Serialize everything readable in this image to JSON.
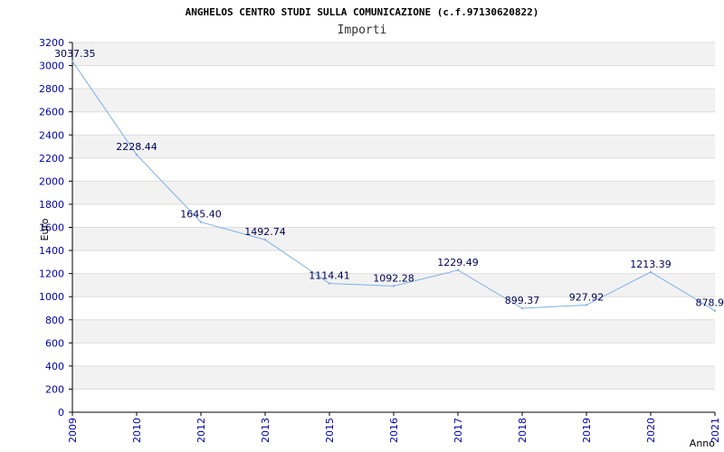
{
  "chart_data": {
    "type": "line",
    "title": "ANGHELOS CENTRO STUDI SULLA COMUNICAZIONE (c.f.97130620822)",
    "subtitle": "Importi",
    "xlabel": "Anno",
    "ylabel": "Euro",
    "categories": [
      "2009",
      "2010",
      "2012",
      "2013",
      "2015",
      "2016",
      "2017",
      "2018",
      "2019",
      "2020",
      "2021"
    ],
    "series": [
      {
        "values": [
          3037.35,
          2228.44,
          1645.4,
          1492.74,
          1114.41,
          1092.28,
          1229.49,
          899.37,
          927.92,
          1213.39,
          878.9
        ],
        "labels": [
          "3037.35",
          "2228.44",
          "1645.40",
          "1492.74",
          "1114.41",
          "1092.28",
          "1229.49",
          "899.37",
          "927.92",
          "1213.39",
          "878.9"
        ]
      }
    ],
    "ylim": [
      0,
      3200
    ],
    "yticks": [
      "0",
      "200",
      "400",
      "600",
      "800",
      "1000",
      "1200",
      "1400",
      "1600",
      "1800",
      "2000",
      "2200",
      "2400",
      "2600",
      "2800",
      "3000",
      "3200"
    ],
    "grid": true,
    "colors": {
      "line": "#7ab0e8",
      "band": "#f2f2f2",
      "gridline": "#dddddd",
      "tick_text": "#0000aa"
    }
  }
}
